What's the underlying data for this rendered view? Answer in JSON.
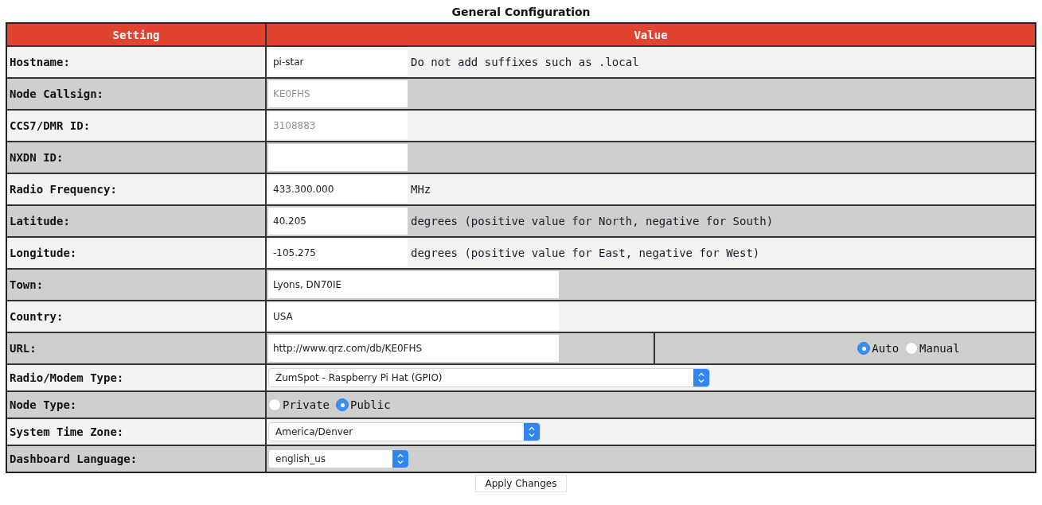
{
  "title": "General Configuration",
  "columns": [
    "Setting",
    "Value"
  ],
  "rows": [
    {
      "label": "Hostname:",
      "kind": "text",
      "value": "pi-star",
      "note": "Do not add suffixes such as .local"
    },
    {
      "label": "Node Callsign:",
      "kind": "text",
      "value": "KE0FHS",
      "blurred": true
    },
    {
      "label": "CCS7/DMR ID:",
      "kind": "text",
      "value": "3108883",
      "blurred": true
    },
    {
      "label": "NXDN ID:",
      "kind": "text"
    },
    {
      "label": "Radio Frequency:",
      "kind": "text",
      "value": "433.300.000",
      "note": "MHz"
    },
    {
      "label": "Latitude:",
      "kind": "text",
      "value": "40.205",
      "note": "degrees (positive value for North, negative for South)"
    },
    {
      "label": "Longitude:",
      "kind": "text",
      "value": "-105.275",
      "note": "degrees (positive value for East, negative for West)"
    },
    {
      "label": "Town:",
      "kind": "wide_text",
      "value": "Lyons, DN70IE"
    },
    {
      "label": "Country:",
      "kind": "wide_text",
      "value": "USA"
    },
    {
      "label": "URL:",
      "kind": "url",
      "value": "http://www.qrz.com/db/KE0FHS",
      "options": [
        {
          "label": "Auto",
          "selected": true
        },
        {
          "label": "Manual",
          "selected": false
        }
      ]
    },
    {
      "label": "Radio/Modem Type:",
      "kind": "select",
      "value": "ZumSpot - Raspberry Pi Hat (GPIO)"
    },
    {
      "label": "Node Type:",
      "kind": "radio",
      "options": [
        {
          "label": "Private",
          "selected": false
        },
        {
          "label": "Public",
          "selected": true
        }
      ]
    },
    {
      "label": "System Time Zone:",
      "kind": "select",
      "value": "America/Denver"
    },
    {
      "label": "Dashboard Language:",
      "kind": "select",
      "value": "english_us"
    }
  ],
  "apply_button": "Apply Changes"
}
